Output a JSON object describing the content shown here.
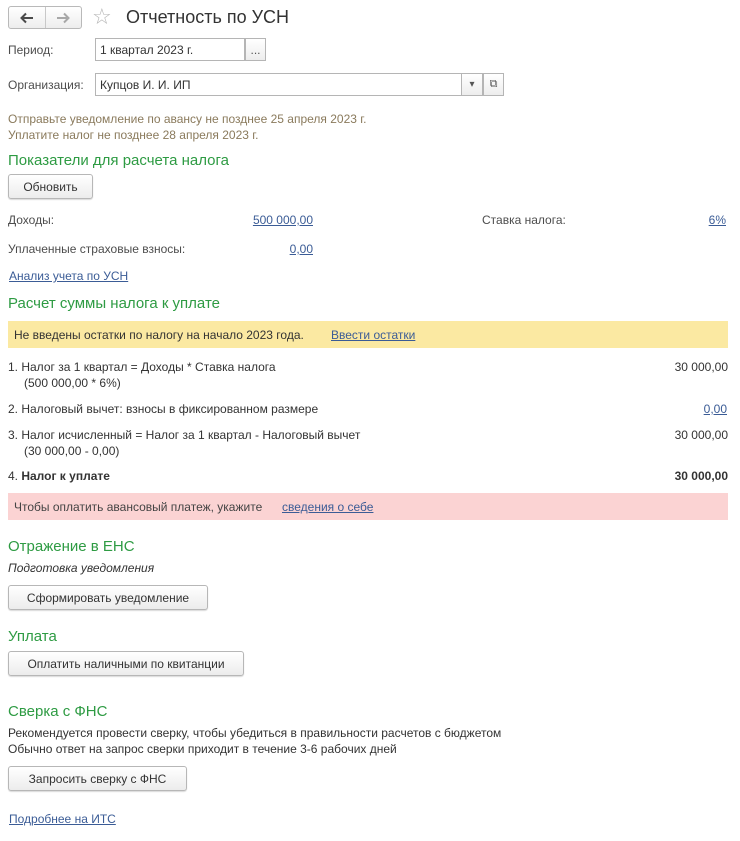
{
  "window": {
    "title": "Отчетность по УСН"
  },
  "period": {
    "label": "Период:",
    "value": "1 квартал 2023 г.",
    "select_button": "..."
  },
  "organization": {
    "label": "Организация:",
    "value": "Купцов И. И. ИП",
    "dropdown_glyph": "▾",
    "open_glyph": "⧉"
  },
  "notices": {
    "line1": "Отправьте уведомление по авансу не позднее 25 апреля 2023 г.",
    "line2": "Уплатите налог не позднее 28 апреля 2023 г."
  },
  "indicators": {
    "heading": "Показатели для расчета налога",
    "refresh_button": "Обновить",
    "income_label": "Доходы:",
    "income_value": "500 000,00",
    "rate_label": "Ставка налога:",
    "rate_value": "6%",
    "insurance_label": "Уплаченные страховые взносы:",
    "insurance_value": "0,00",
    "analysis_link": "Анализ учета по УСН"
  },
  "calculation": {
    "heading": "Расчет суммы налога к уплате",
    "warning_text": "Не введены остатки по налогу на начало 2023 года.",
    "warning_link": "Ввести остатки",
    "row1_text": "1. Налог за 1 квартал = Доходы * Ставка налога",
    "row1_sub": "(500 000,00 * 6%)",
    "row1_value": "30 000,00",
    "row2_text": "2. Налоговый вычет: взносы в фиксированном размере",
    "row2_value": "0,00",
    "row3_text": "3. Налог исчисленный = Налог за 1 квартал - Налоговый вычет",
    "row3_sub": "(30 000,00 - 0,00)",
    "row3_value": "30 000,00",
    "row4_prefix": "4. ",
    "row4_text": "Налог к уплате",
    "row4_value": "30 000,00",
    "payment_text": "Чтобы оплатить авансовый платеж, укажите",
    "payment_link": "сведения о себе"
  },
  "ens": {
    "heading": "Отражение в ЕНС",
    "subtitle": "Подготовка уведомления",
    "button": "Сформировать уведомление"
  },
  "payment": {
    "heading": "Уплата",
    "button": "Оплатить наличными по квитанции"
  },
  "fns": {
    "heading": "Сверка с ФНС",
    "line1": "Рекомендуется провести сверку, чтобы убедиться в правильности расчетов с бюджетом",
    "line2": "Обычно ответ на запрос сверки приходит в течение 3-6 рабочих дней",
    "button": "Запросить сверку с ФНС",
    "more_link": "Подробнее на ИТС"
  }
}
